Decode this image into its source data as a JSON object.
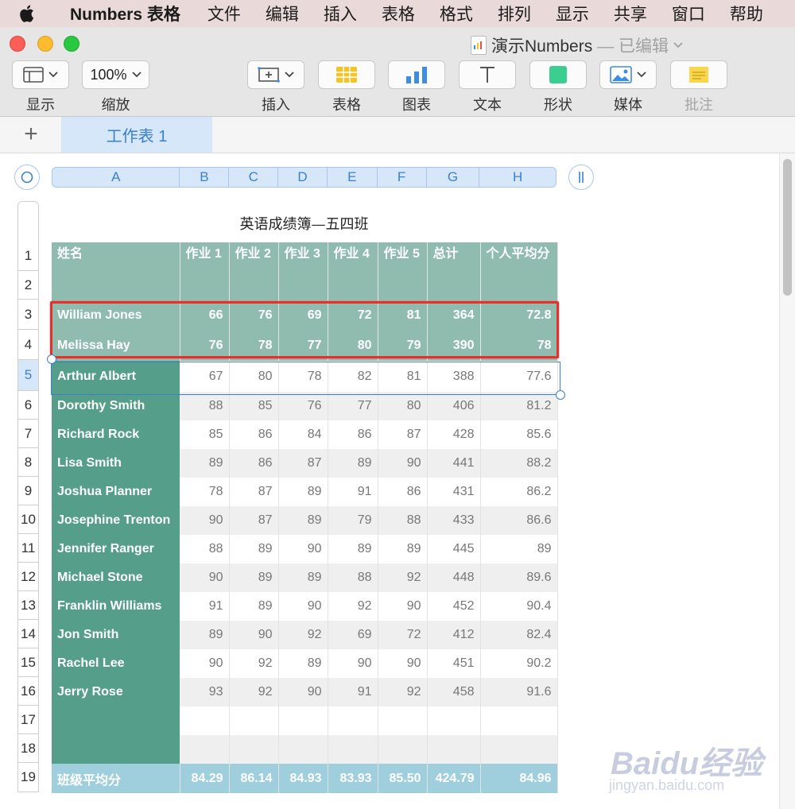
{
  "menubar": {
    "app_name": "Numbers 表格",
    "items": [
      "文件",
      "编辑",
      "插入",
      "表格",
      "格式",
      "排列",
      "显示",
      "共享",
      "窗口",
      "帮助"
    ]
  },
  "window": {
    "doc_name": "演示Numbers",
    "edited_label": "— 已编辑"
  },
  "toolbar": {
    "view_label": "显示",
    "zoom_value": "100%",
    "zoom_label": "缩放",
    "insert_label": "插入",
    "table_label": "表格",
    "chart_label": "图表",
    "text_label": "文本",
    "shape_label": "形状",
    "media_label": "媒体",
    "comment_label": "批注",
    "colors": {
      "table_icon": "#f6c325",
      "chart_icon": "#3c8ce8",
      "shape_icon": "#3bcf8f",
      "media_icon": "#3c8ce8",
      "comment_icon": "#f8d74d"
    }
  },
  "tabs": {
    "add_label": "+",
    "sheet_name": "工作表 1"
  },
  "sheet": {
    "title": "英语成绩簿—五四班",
    "column_letters": [
      "A",
      "B",
      "C",
      "D",
      "E",
      "F",
      "G",
      "H"
    ],
    "row_numbers": [
      "1",
      "2",
      "3",
      "4",
      "5",
      "6",
      "7",
      "8",
      "9",
      "10",
      "11",
      "12",
      "13",
      "14",
      "15",
      "16",
      "17",
      "18",
      "19"
    ],
    "selected_row": "5",
    "headers": [
      "姓名",
      "作业 1",
      "作业 2",
      "作业 3",
      "作业 4",
      "作业 5",
      "总计",
      "个人平均分"
    ],
    "header_rows": [
      {
        "name": "William Jones",
        "values": [
          "66",
          "76",
          "69",
          "72",
          "81",
          "364",
          "72.8"
        ]
      },
      {
        "name": "Melissa Hay",
        "values": [
          "76",
          "78",
          "77",
          "80",
          "79",
          "390",
          "78"
        ]
      }
    ],
    "body_rows": [
      {
        "name": "Arthur Albert",
        "values": [
          "67",
          "80",
          "78",
          "82",
          "81",
          "388",
          "77.6"
        ]
      },
      {
        "name": "Dorothy Smith",
        "values": [
          "88",
          "85",
          "76",
          "77",
          "80",
          "406",
          "81.2"
        ]
      },
      {
        "name": "Richard Rock",
        "values": [
          "85",
          "86",
          "84",
          "86",
          "87",
          "428",
          "85.6"
        ]
      },
      {
        "name": "Lisa Smith",
        "values": [
          "89",
          "86",
          "87",
          "89",
          "90",
          "441",
          "88.2"
        ]
      },
      {
        "name": "Joshua Planner",
        "values": [
          "78",
          "87",
          "89",
          "91",
          "86",
          "431",
          "86.2"
        ]
      },
      {
        "name": "Josephine Trenton",
        "values": [
          "90",
          "87",
          "89",
          "79",
          "88",
          "433",
          "86.6"
        ]
      },
      {
        "name": "Jennifer Ranger",
        "values": [
          "88",
          "89",
          "90",
          "89",
          "89",
          "445",
          "89"
        ]
      },
      {
        "name": "Michael Stone",
        "values": [
          "90",
          "89",
          "89",
          "88",
          "92",
          "448",
          "89.6"
        ]
      },
      {
        "name": "Franklin Williams",
        "values": [
          "91",
          "89",
          "90",
          "92",
          "90",
          "452",
          "90.4"
        ]
      },
      {
        "name": "Jon Smith",
        "values": [
          "89",
          "90",
          "92",
          "69",
          "72",
          "412",
          "82.4"
        ]
      },
      {
        "name": "Rachel Lee",
        "values": [
          "90",
          "92",
          "89",
          "90",
          "90",
          "451",
          "90.2"
        ]
      },
      {
        "name": "Jerry Rose",
        "values": [
          "93",
          "92",
          "90",
          "91",
          "92",
          "458",
          "91.6"
        ]
      },
      {
        "name": "",
        "values": [
          "",
          "",
          "",
          "",
          "",
          "",
          ""
        ]
      },
      {
        "name": "",
        "values": [
          "",
          "",
          "",
          "",
          "",
          "",
          ""
        ]
      }
    ],
    "footer": {
      "name": "班级平均分",
      "values": [
        "84.29",
        "86.14",
        "84.93",
        "83.93",
        "85.50",
        "424.79",
        "84.96"
      ]
    }
  },
  "watermark": {
    "brand": "Baidu经验",
    "url": "jingyan.baidu.com"
  }
}
